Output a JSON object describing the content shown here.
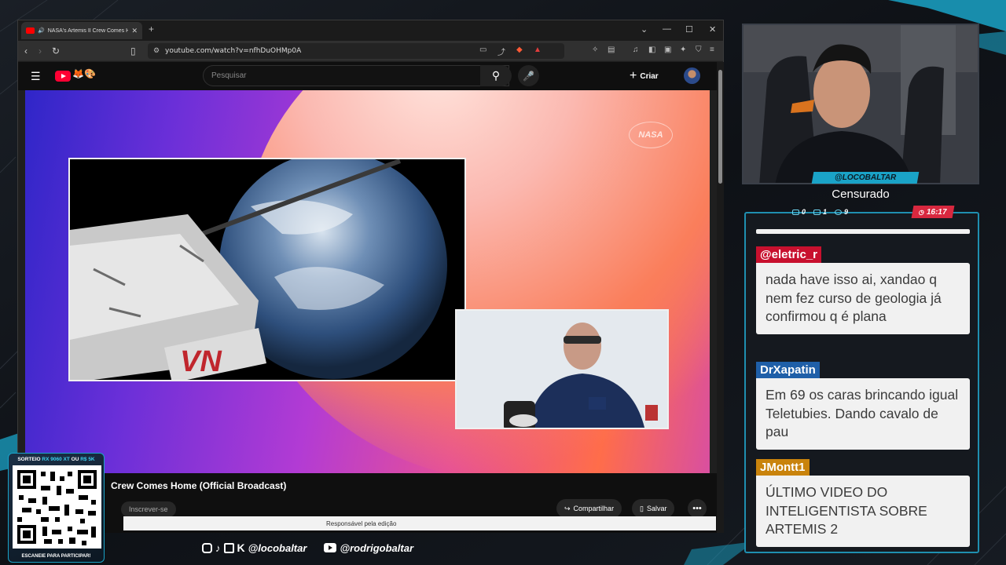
{
  "browser": {
    "tab_title": "NASA's Artemis II Crew Comes Hom",
    "url": "youtube.com/watch?v=nfhDuOHMp0A",
    "new_tab_icon": "plus-icon"
  },
  "youtube": {
    "search_placeholder": "Pesquisar",
    "create_label": "Criar",
    "video_title": "Crew Comes Home (Official Broadcast)",
    "subscribe_label": "Inscrever-se",
    "share_label": "Compartilhar",
    "save_label": "Salvar",
    "caption_text": "Responsável pela edição",
    "nasa_logo": "NASA"
  },
  "stream": {
    "streamer_name": "@LOCOBALTAR",
    "status": "Censurado",
    "stats": {
      "chat": "0",
      "youtube": "1",
      "viewers": "9"
    },
    "timer": "16:17"
  },
  "chat": [
    {
      "user": "@eletric_r",
      "color": "#c8102e",
      "message": "nada have isso ai, xandao q nem fez curso de geologia já confirmou q é plana"
    },
    {
      "user": "DrXapatin",
      "color": "#1f5fa8",
      "message": "Em 69 os caras brincando igual Teletubies. Dando cavalo de pau"
    },
    {
      "user": "JMontt1",
      "color": "#c9830c",
      "message": "ÚLTIMO VIDEO DO INTELIGENTISTA SOBRE ARTEMIS 2"
    }
  ],
  "qr": {
    "header_prefix": "SORTEIO ",
    "header_hl1": "RX 9060 XT",
    "header_mid": " OU ",
    "header_hl2": "R$ 5K",
    "footer": "ESCANEIE PARA PARTICIPAR!"
  },
  "social": {
    "handle_1": "@locobaltar",
    "handle_2": "@rodrigobaltar"
  },
  "colors": {
    "accent": "#1aa3c7",
    "timer_bg": "#d8283f",
    "youtube_red": "#ff0033"
  }
}
